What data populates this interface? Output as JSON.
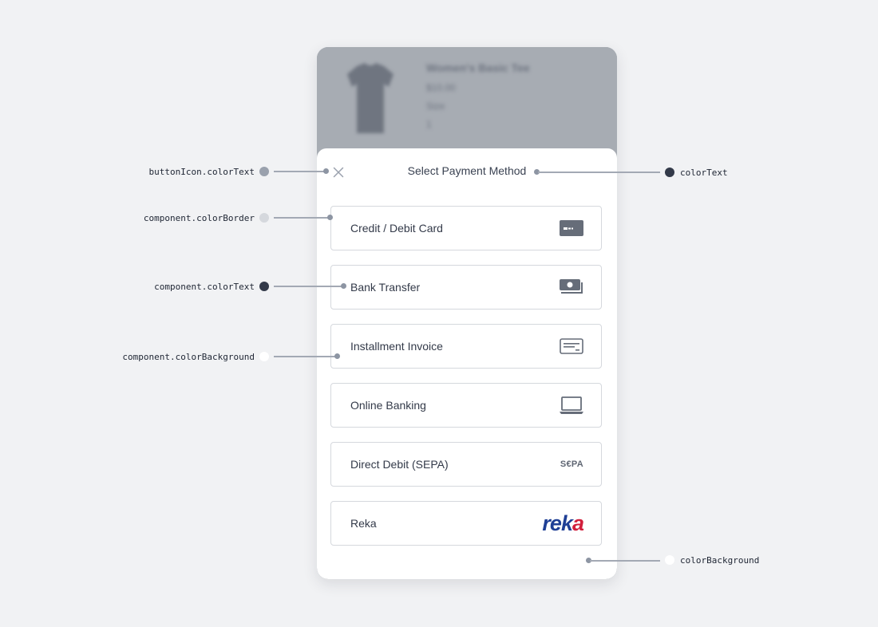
{
  "product": {
    "name": "Women's Basic Tee",
    "price": "$10.00",
    "size": "Size",
    "quantity": "1"
  },
  "sheet": {
    "title": "Select Payment Method",
    "close_icon": "close-icon"
  },
  "methods": [
    {
      "label": "Credit / Debit Card",
      "icon": "credit-card-icon"
    },
    {
      "label": "Bank Transfer",
      "icon": "banknotes-icon"
    },
    {
      "label": "Installment Invoice",
      "icon": "invoice-icon"
    },
    {
      "label": "Online Banking",
      "icon": "laptop-icon"
    },
    {
      "label": "Direct Debit (SEPA)",
      "icon": "sepa-logo",
      "logo_text": "S€PA"
    },
    {
      "label": "Reka",
      "icon": "reka-logo",
      "logo_text_1": "rek",
      "logo_text_2": "a"
    }
  ],
  "annotations": {
    "button_icon_color_text": "buttonIcon.colorText",
    "component_color_border": "component.colorBorder",
    "component_color_text": "component.colorText",
    "component_color_background": "component.colorBackground",
    "color_text": "colorText",
    "color_background": "colorBackground"
  },
  "colors": {
    "page_background": "#f1f2f4",
    "button_icon_text": "#9aa1ad",
    "component_border": "#d5d8dd",
    "component_text": "#333a49",
    "component_background": "#ffffff",
    "text": "#333a49",
    "background": "#ffffff",
    "reka_blue": "#1f3f95",
    "reka_red": "#d21f3c"
  }
}
